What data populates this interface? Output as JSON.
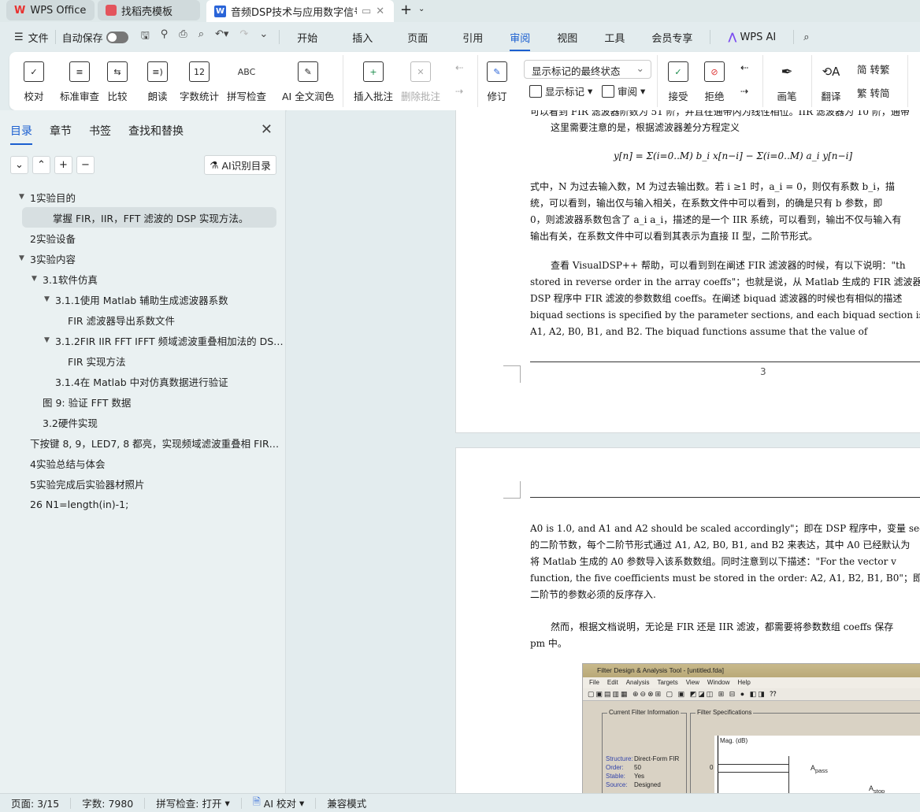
{
  "tabs": [
    {
      "label": "WPS Office",
      "icon": "wps-logo-icon",
      "active": false
    },
    {
      "label": "找稻壳模板",
      "icon": "docer-icon",
      "active": false
    },
    {
      "label": "音频DSP技术与应用数字信号",
      "icon": "word-doc-icon",
      "active": true
    }
  ],
  "menu": {
    "file": "文件",
    "autosave": "自动保存",
    "items": [
      "开始",
      "插入",
      "页面",
      "引用",
      "审阅",
      "视图",
      "工具",
      "会员专享"
    ],
    "selected": "审阅",
    "wps_ai": "WPS AI"
  },
  "ribbon": {
    "proofread": "校对",
    "standard_review": "标准审查",
    "compare": "比较",
    "read_aloud": "朗读",
    "word_count": "字数统计",
    "spell_check": "拼写检查",
    "ai_polish": "AI 全文润色",
    "insert_comment": "插入批注",
    "delete_comment": "删除批注",
    "track_changes": "修订",
    "markup_select": "显示标记的最终状态",
    "show_markup": "显示标记",
    "review": "审阅",
    "accept": "接受",
    "reject": "拒绝",
    "pen": "画笔",
    "translate": "翻译",
    "to_traditional": "转繁",
    "to_simplified": "转简",
    "word_count_icon_text": "12",
    "spell_icon_text": "ABC"
  },
  "panel": {
    "tabs": [
      "目录",
      "章节",
      "书签",
      "查找和替换"
    ],
    "ai_toc": "AI识别目录",
    "toc": [
      {
        "label": "1实验目的",
        "level": 0,
        "expanded": true
      },
      {
        "label": "掌握 FIR，IIR，FFT 滤波的 DSP 实现方法。",
        "level": 1,
        "selected": true
      },
      {
        "label": "2实验设备",
        "level": 0
      },
      {
        "label": "3实验内容",
        "level": 0,
        "expanded": true
      },
      {
        "label": "3.1软件仿真",
        "level": 1,
        "expanded": true
      },
      {
        "label": "3.1.1使用 Matlab 辅助生成滤波器系数",
        "level": 2,
        "expanded": true
      },
      {
        "label": "FIR 滤波器导出系数文件",
        "level": 3
      },
      {
        "label": "3.1.2FIR IIR FFT IFFT 频域滤波重叠相加法的 DS…",
        "level": 2,
        "expanded": true
      },
      {
        "label": "FIR 实现方法",
        "level": 3
      },
      {
        "label": "3.1.4在 Matlab 中对仿真数据进行验证",
        "level": 2
      },
      {
        "label": "图 9: 验证 FFT 数据",
        "level": 1
      },
      {
        "label": "3.2硬件实现",
        "level": 1
      },
      {
        "label": "下按键 8, 9，LED7, 8 都亮，实现频域滤波重叠相 FIR…",
        "level": 0
      },
      {
        "label": "4实验总结与体会",
        "level": 0
      },
      {
        "label": "5实验完成后实验器材照片",
        "level": 0
      },
      {
        "label": "26  N1=length(in)-1;",
        "level": 0
      }
    ]
  },
  "doc": {
    "page1": {
      "cut_line": "可以看到 FIR 滤波器阶数为 51 阶，并且在通带内为线性相位。IIR 滤波器为 10 阶，通带",
      "p1": "这里需要注意的是，根据滤波器差分方程定义",
      "formula": "y[n] = Σ(i=0..M) b_i x[n−i] − Σ(i=0..M) a_i y[n−i]",
      "p2": [
        "式中，N 为过去输入数，M 为过去输出数。若 i ≥1 时，a_i = 0，则仅有系数 b_i，描",
        "统，可以看到，输出仅与输入相关，在系数文件中可以看到，的确是只有 b 参数，即",
        "0，则滤波器系数包含了 a_i a_i，描述的是一个 IIR 系统，可以看到，输出不仅与输入有",
        "输出有关，在系数文件中可以看到其表示为直接 II 型，二阶节形式。"
      ],
      "p3": [
        "查看 VisualDSP++ 帮助，可以看到到在阐述 FIR 滤波器的时候，有以下说明：\"th",
        "stored in reverse order in the array coeffs\"；也就是说，从 Matlab 生成的 FIR 滤波器参数",
        "DSP 程序中 FIR 滤波的参数数组 coeffs。在阐述 biquad 滤波器的时候也有相似的描述",
        "biquad sections is specified by the parameter sections, and each biquad section is represented",
        "A1, A2, B0, B1, and B2. The biquad functions assume that the value of"
      ],
      "page_number": "3"
    },
    "page2": {
      "p1": [
        "A0 is 1.0, and A1 and A2 should be scaled accordingly\"；即在 DSP 程序中，变量 section 指",
        "的二阶节数，每个二阶节形式通过 A1, A2, B0, B1, and B2 来表达，其中 A0 已经默认为",
        "将 Matlab 生成的 A0 参数导入该系数数组。同时注意到以下描述：\"For the vector v",
        "function, the five coefficients must be stored in the order: A2, A1, B2, B1, B0\"；即同 FI",
        "二阶节的参数必须的反序存入."
      ],
      "p2": [
        "然而，根据文档说明，无论是 FIR 还是 IIR 滤波，都需要将参数数组 coeffs 保存",
        "pm 中。"
      ],
      "figure": {
        "title": "Filter Design & Analysis Tool - [untitled.fda]",
        "menu": [
          "File",
          "Edit",
          "Analysis",
          "Targets",
          "View",
          "Window",
          "Help"
        ],
        "current_info": "Current Filter Information",
        "specs": "Filter Specifications",
        "fields": [
          [
            "Structure:",
            "Direct-Form FIR"
          ],
          [
            "Order:",
            "50"
          ],
          [
            "Stable:",
            "Yes"
          ],
          [
            "Source:",
            "Designed"
          ]
        ],
        "mag": "Mag. (dB)",
        "zero": "0",
        "apass": "pass",
        "astop": "stop",
        "a": "A"
      }
    }
  },
  "status": {
    "page": "页面: 3/15",
    "words": "字数: 7980",
    "spell": "拼写检查: 打开",
    "ai_check": "AI 校对",
    "compat": "兼容模式"
  },
  "colors": {
    "accent": "#1b5fd0",
    "wps_red": "#e8312f"
  }
}
